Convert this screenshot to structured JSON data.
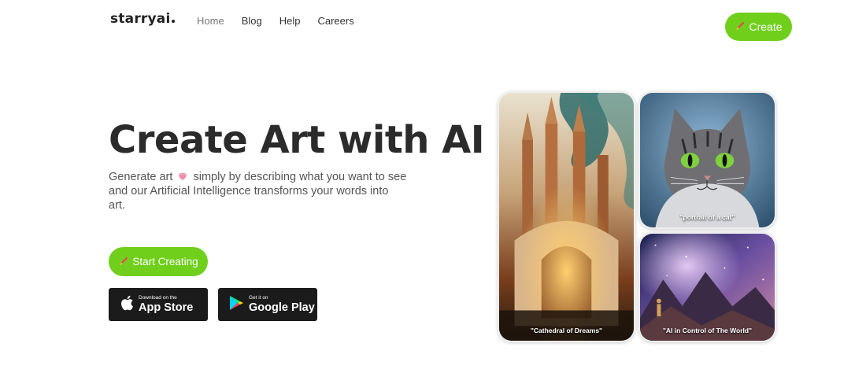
{
  "header": {
    "logo": "starryai",
    "nav": [
      {
        "label": "Home",
        "active": true
      },
      {
        "label": "Blog",
        "active": false
      },
      {
        "label": "Help",
        "active": false
      },
      {
        "label": "Careers",
        "active": false
      }
    ],
    "create_label": "Create"
  },
  "hero": {
    "title": "Create Art with AI",
    "desc_part1": "Generate art",
    "desc_part2": "simply by describing what you want to see and our Artificial Intelligence transforms your words into art.",
    "start_label": "Start Creating"
  },
  "stores": {
    "apple_small": "Download on the",
    "apple_big": "App Store",
    "google_small": "Get it on",
    "google_big": "Google Play"
  },
  "gallery": {
    "cathedral_caption": "\"Cathedral of Dreams\"",
    "cat_caption": "\"portrait of a cat\"",
    "space_caption": "\"AI in Control of The World\""
  },
  "colors": {
    "accent": "#6fcf1a",
    "store_bg": "#1b1b1b"
  },
  "icons": [
    "brush-icon",
    "brain-icon",
    "apple-icon",
    "google-play-icon"
  ]
}
